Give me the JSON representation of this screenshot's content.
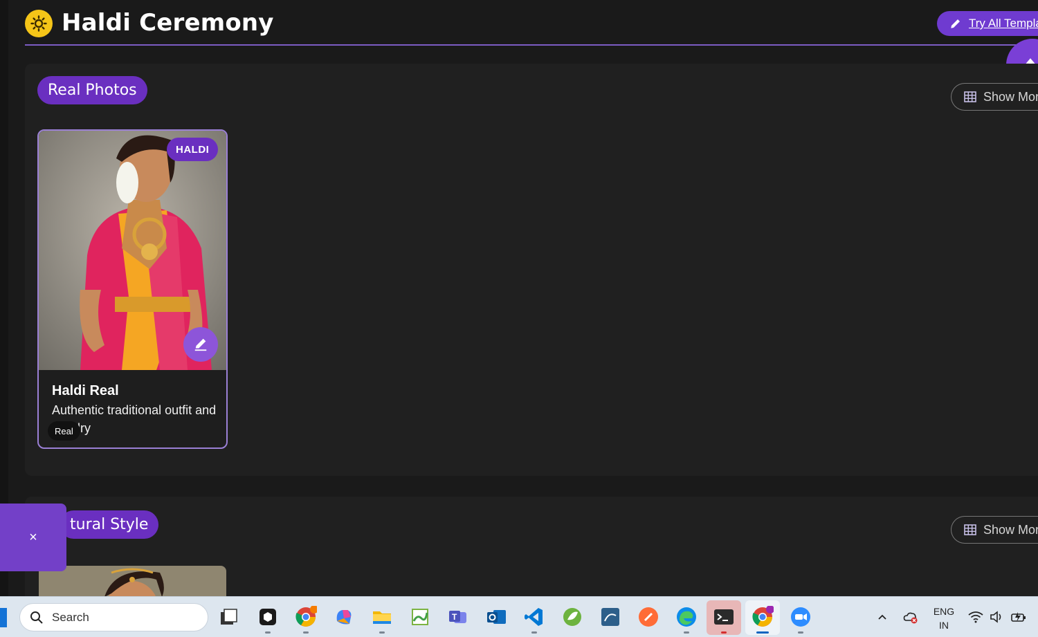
{
  "header": {
    "title": "Haldi Ceremony",
    "try_button_label": "Try All Templa"
  },
  "sections": [
    {
      "pill_label": "Real Photos",
      "show_more_label": "Show More",
      "card": {
        "badge": "HALDI",
        "title": "Haldi Real",
        "description": "Authentic traditional outfit and jewelry",
        "tag": "Real"
      }
    },
    {
      "pill_label": "tural Style",
      "show_more_label": "Show More"
    }
  ],
  "overlay": {
    "close_label": "×"
  },
  "taskbar": {
    "search_placeholder": "Search",
    "language_line1": "ENG",
    "language_line2": "IN",
    "apps": [
      "task-view",
      "app-cube",
      "chrome",
      "copilot",
      "file-explorer",
      "notepad",
      "teams",
      "outlook",
      "vscode",
      "spring",
      "mysql-workbench",
      "postman",
      "edge",
      "terminal",
      "chrome-profile",
      "zoom"
    ]
  },
  "colors": {
    "accent": "#6a2fc0",
    "background": "#1a1a1a",
    "card_border": "#9b80d6",
    "logo": "#f5c518",
    "taskbar": "#dde6ef"
  }
}
